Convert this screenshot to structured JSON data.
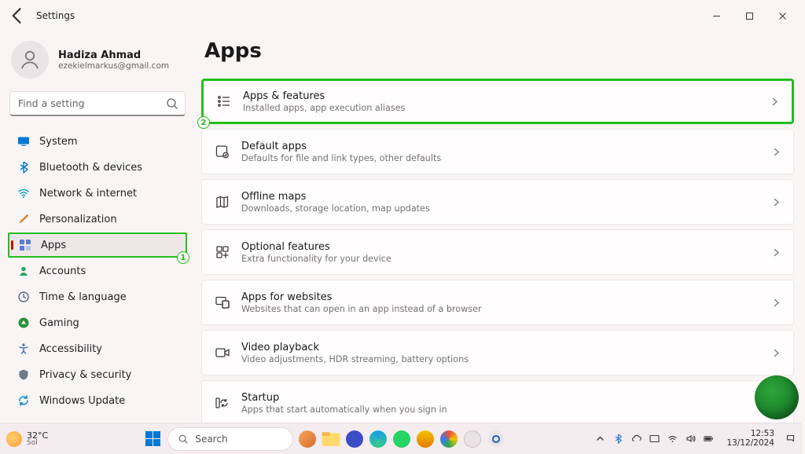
{
  "window": {
    "title": "Settings"
  },
  "user": {
    "name": "Hadiza Ahmad",
    "email": "ezekielmarkus@gmail.com"
  },
  "search": {
    "placeholder": "Find a setting"
  },
  "sidebar": {
    "items": [
      {
        "label": "System"
      },
      {
        "label": "Bluetooth & devices"
      },
      {
        "label": "Network & internet"
      },
      {
        "label": "Personalization"
      },
      {
        "label": "Apps",
        "active": true,
        "annotation": "1"
      },
      {
        "label": "Accounts"
      },
      {
        "label": "Time & language"
      },
      {
        "label": "Gaming"
      },
      {
        "label": "Accessibility"
      },
      {
        "label": "Privacy & security"
      },
      {
        "label": "Windows Update"
      }
    ]
  },
  "page": {
    "title": "Apps",
    "cards": [
      {
        "title": "Apps & features",
        "sub": "Installed apps, app execution aliases",
        "annotation": "2"
      },
      {
        "title": "Default apps",
        "sub": "Defaults for file and link types, other defaults"
      },
      {
        "title": "Offline maps",
        "sub": "Downloads, storage location, map updates"
      },
      {
        "title": "Optional features",
        "sub": "Extra functionality for your device"
      },
      {
        "title": "Apps for websites",
        "sub": "Websites that can open in an app instead of a browser"
      },
      {
        "title": "Video playback",
        "sub": "Video adjustments, HDR streaming, battery options"
      },
      {
        "title": "Startup",
        "sub": "Apps that start automatically when you sign in"
      }
    ]
  },
  "taskbar": {
    "weather": {
      "temp": "32°C",
      "desc": "Sol"
    },
    "search": "Search",
    "clock": {
      "time": "12:53",
      "date": "13/12/2024"
    }
  },
  "annotations": {
    "one": "1",
    "two": "2"
  }
}
